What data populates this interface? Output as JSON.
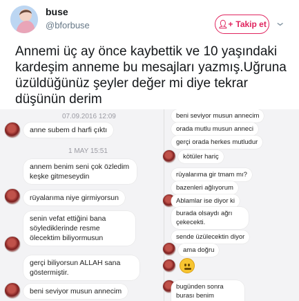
{
  "header": {
    "name": "buse",
    "handle": "@bforbuse",
    "follow_label": "Takip et",
    "follow_icon": "person-add-icon",
    "menu_icon": "chevron-down-icon",
    "accent": "#e0245e"
  },
  "tweet": {
    "text": "Annemi üç ay önce kaybettik ve 10 yaşındaki kardeşim anneme bu mesajları yazmış.Uğruna üzüldüğünüz şeyler değer mi diye tekrar düşünün derim"
  },
  "left_chat": {
    "stamp1": "07.09.2016 12:09",
    "stamp2": "1 MAY 15:51",
    "messages": [
      "anne subem d harfi çıktı",
      "annem benim seni çok özledim keşke gitmeseydin",
      "rüyalarıma niye girmiyorsun",
      "senin vefat ettiğini bana söylediklerinde resme ölecektim biliyormusun",
      "gerçi biliyorsun ALLAH sana göstermiştir.",
      "beni seviyor musun annecim"
    ]
  },
  "right_chat": {
    "messages": [
      "beni seviyor musun annecim",
      "orada mutlu musun anneci",
      "gerçi orada herkes mutludur",
      "kötüler hariç",
      "rüyalarıma gir tmam mı?",
      "bazenleri ağlıyorum",
      "Ablamlar ise diyor ki",
      "burada olsaydı ağrı çekecekti.",
      "sende üzülecektin diyor",
      "ama doğru",
      "bugünden sonra burası benim günlüğüm"
    ]
  }
}
